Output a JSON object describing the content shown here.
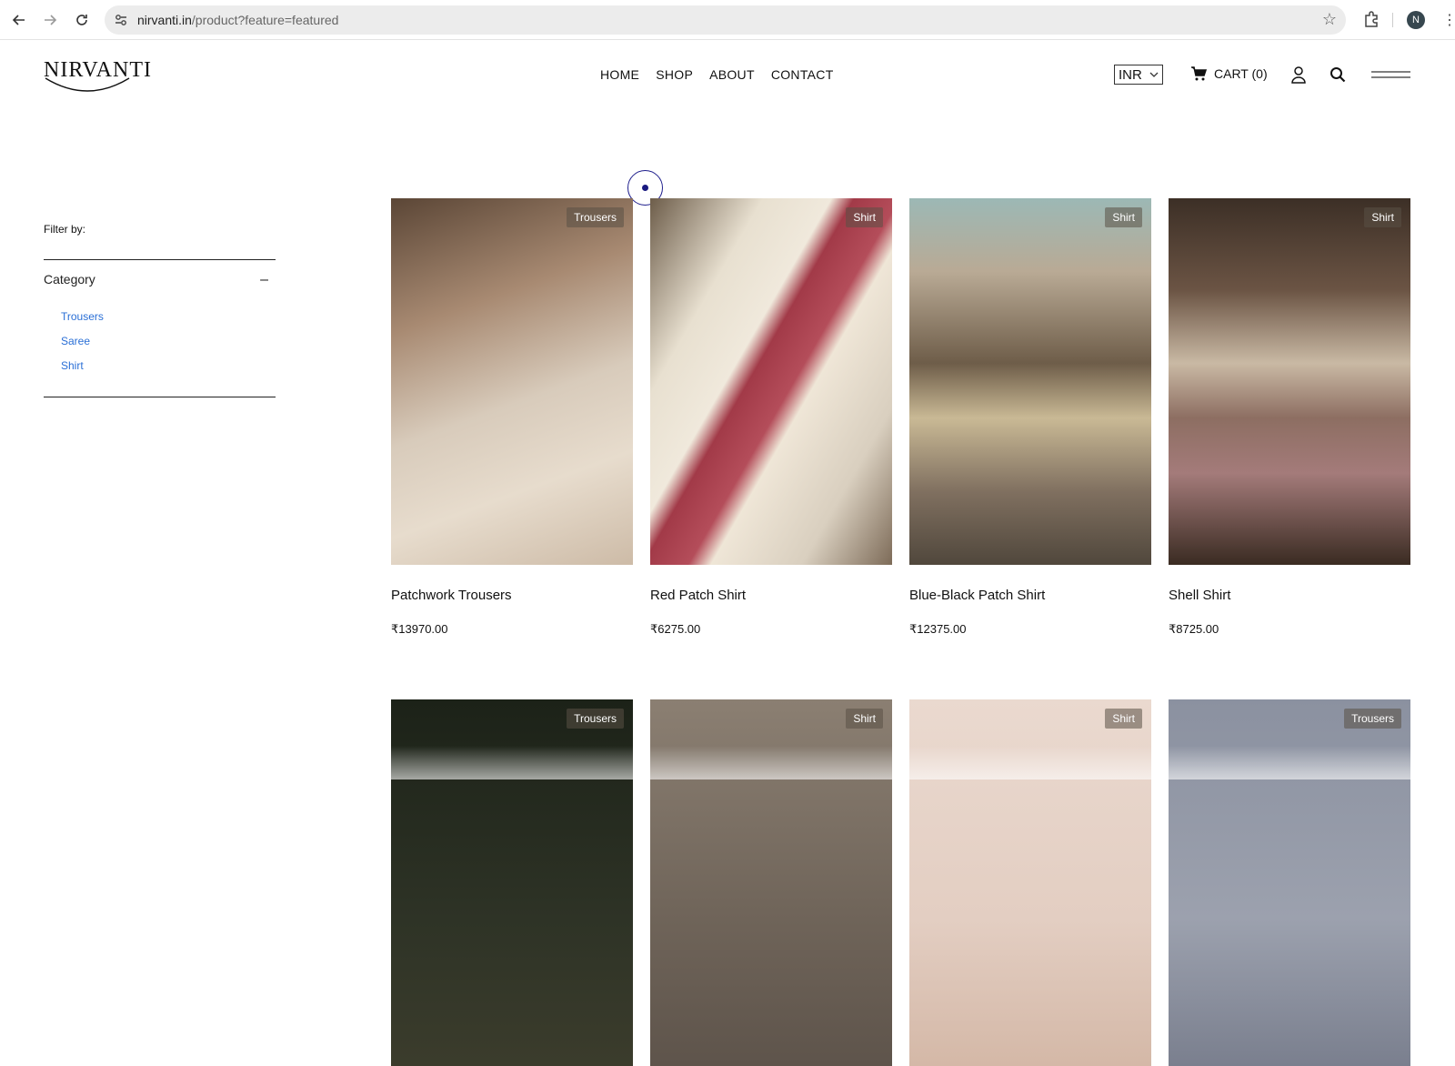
{
  "browser": {
    "url_host": "nirvanti.in",
    "url_path": "/product?feature=featured",
    "profile_initial": "N"
  },
  "header": {
    "logo_text": "NIRVANTI",
    "nav": [
      "HOME",
      "SHOP",
      "ABOUT",
      "CONTACT"
    ],
    "currency": "INR",
    "cart_label": "CART (0)"
  },
  "sidebar": {
    "filter_title": "Filter by:",
    "category_label": "Category",
    "categories": [
      "Trousers",
      "Saree",
      "Shirt"
    ]
  },
  "products": [
    {
      "name": "Patchwork Trousers",
      "price": "₹13970.00",
      "badge": "Trousers"
    },
    {
      "name": "Red Patch Shirt",
      "price": "₹6275.00",
      "badge": "Shirt"
    },
    {
      "name": "Blue-Black Patch Shirt",
      "price": "₹12375.00",
      "badge": "Shirt"
    },
    {
      "name": "Shell Shirt",
      "price": "₹8725.00",
      "badge": "Shirt"
    },
    {
      "badge": "Trousers"
    },
    {
      "badge": "Shirt"
    },
    {
      "badge": "Shirt"
    },
    {
      "badge": "Trousers"
    }
  ],
  "colors": {
    "link_blue": "#2a6fd6",
    "cursor": "#1e1e8c"
  }
}
